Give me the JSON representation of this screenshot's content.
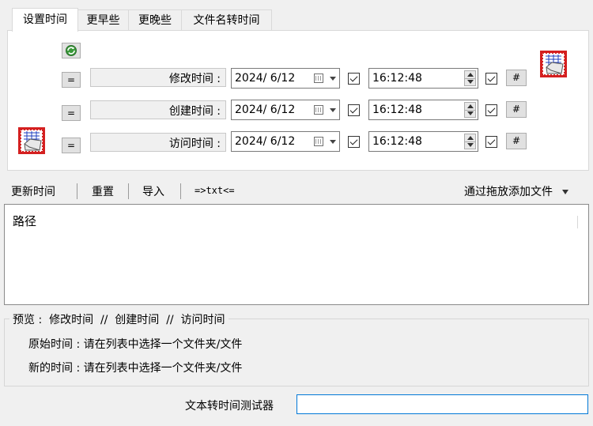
{
  "tabs": [
    "设置时间",
    "更早些",
    "更晚些",
    "文件名转时间"
  ],
  "rows": [
    {
      "label": "修改时间 :",
      "date": "2024/  6/12",
      "time": "16:12:48",
      "eq": "=",
      "hash": "#"
    },
    {
      "label": "创建时间 :",
      "date": "2024/  6/12",
      "time": "16:12:48",
      "eq": "=",
      "hash": "#"
    },
    {
      "label": "访问时间 :",
      "date": "2024/  6/12",
      "time": "16:12:48",
      "eq": "=",
      "hash": "#"
    }
  ],
  "toolbar": {
    "update": "更新时间",
    "reset": "重置",
    "import": "导入",
    "txt": "=>txt<=",
    "drag_add": "通过拖放添加文件"
  },
  "list": {
    "column_path": "路径"
  },
  "preview": {
    "legend": "预览 :  修改时间  //  创建时间  //  访问时间",
    "original": "原始时间 : 请在列表中选择一个文件夹/文件",
    "new": "新的时间 : 请在列表中选择一个文件夹/文件"
  },
  "tester": {
    "label": "文本转时间测试器",
    "value": ""
  },
  "icons": {
    "refresh": "refresh-globe-icon",
    "app_top": "folder-grid-app-icon",
    "app_left": "folder-grid-app-icon",
    "calendar": "calendar-icon",
    "dropdown": "chevron-down-icon"
  },
  "colors": {
    "focus_border": "#0078d7",
    "app_icon_red": "#d42020",
    "app_icon_blue": "#1f3fbf"
  }
}
